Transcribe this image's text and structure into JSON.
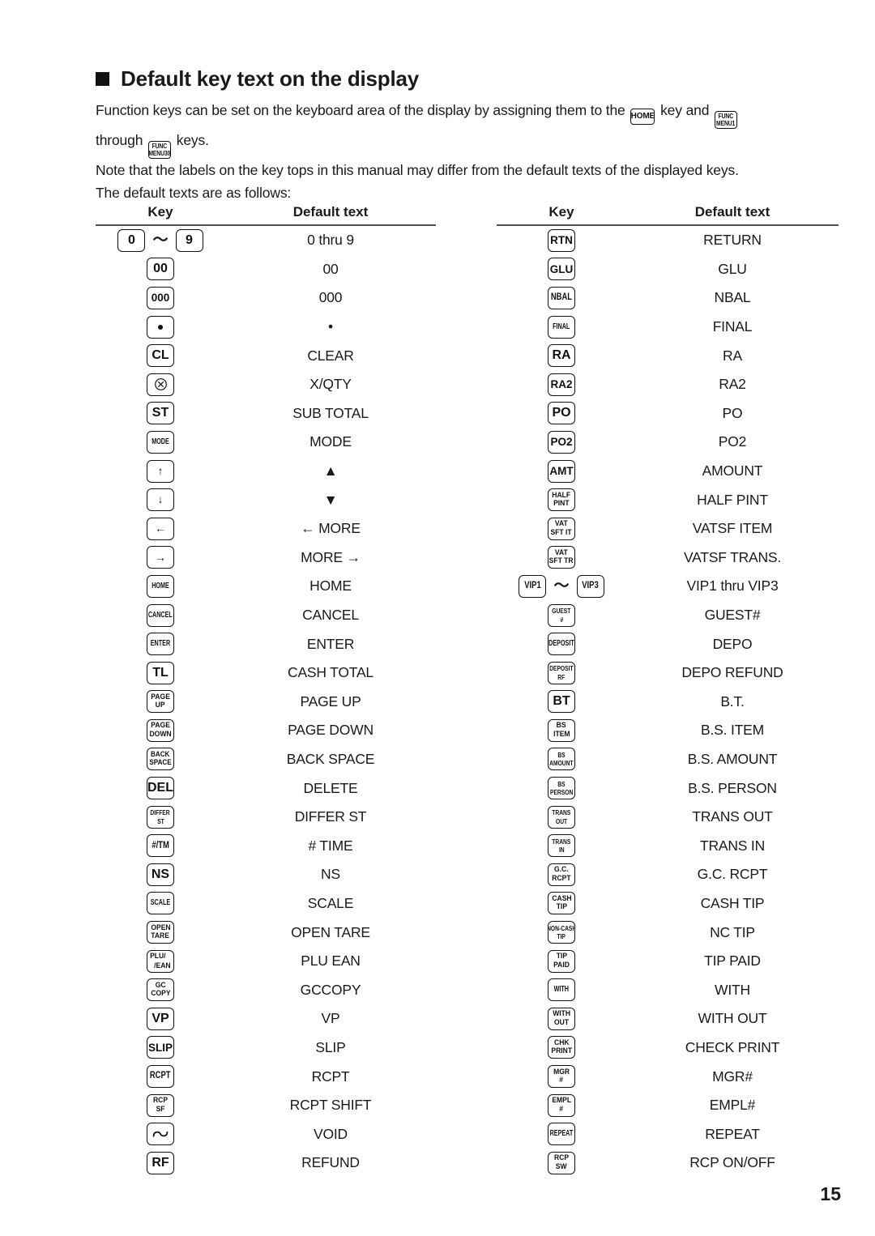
{
  "heading": {
    "bullet": "filled-square",
    "title": "Default key text on the display"
  },
  "intro": {
    "line1_a": "Function keys can be set on the keyboard area of the display by assigning them to the",
    "key_home": "HOME",
    "line1_b": "key and",
    "key_func_menu1_l1": "FUNC",
    "key_func_menu1_l2": "MENU1",
    "line2_a": "through",
    "key_func_menu30_l1": "FUNC",
    "key_func_menu30_l2": "MENU30",
    "line2_b": "keys.",
    "line3": "Note that the labels on the key tops in this manual may differ from the default texts of the displayed keys.",
    "line4": "The default texts are as follows:"
  },
  "table_headers": {
    "key": "Key",
    "default_text": "Default text"
  },
  "left_rows": [
    {
      "keys": [
        {
          "l1": "0",
          "style": "s1"
        },
        {
          "tilde": "〜"
        },
        {
          "l1": "9",
          "style": "s1"
        }
      ],
      "text": "0 thru 9"
    },
    {
      "keys": [
        {
          "l1": "00",
          "style": "s1"
        }
      ],
      "text": "00"
    },
    {
      "keys": [
        {
          "l1": "000",
          "style": "s2"
        }
      ],
      "text": "000"
    },
    {
      "keys": [
        {
          "glyph": "dot"
        }
      ],
      "text": "•"
    },
    {
      "keys": [
        {
          "l1": "CL",
          "style": "s1"
        }
      ],
      "text": "CLEAR"
    },
    {
      "keys": [
        {
          "glyph": "circle-x"
        }
      ],
      "text": "X/QTY"
    },
    {
      "keys": [
        {
          "l1": "ST",
          "style": "s1"
        }
      ],
      "text": "SUB TOTAL"
    },
    {
      "keys": [
        {
          "l1": "MODE",
          "style": "s4"
        }
      ],
      "text": "MODE"
    },
    {
      "keys": [
        {
          "l1": "↑",
          "style": "s2"
        }
      ],
      "text": "▲"
    },
    {
      "keys": [
        {
          "l1": "↓",
          "style": "s2"
        }
      ],
      "text": "▼"
    },
    {
      "keys": [
        {
          "l1": "←",
          "style": "s2"
        }
      ],
      "text": "← MORE"
    },
    {
      "keys": [
        {
          "l1": "→",
          "style": "s2"
        }
      ],
      "text": "MORE →"
    },
    {
      "keys": [
        {
          "l1": "HOME",
          "style": "s4"
        }
      ],
      "text": "HOME"
    },
    {
      "keys": [
        {
          "l1": "CANCEL",
          "style": "s4"
        }
      ],
      "text": "CANCEL"
    },
    {
      "keys": [
        {
          "l1": "ENTER",
          "style": "s4"
        }
      ],
      "text": "ENTER"
    },
    {
      "keys": [
        {
          "l1": "TL",
          "style": "s1"
        }
      ],
      "text": "CASH TOTAL"
    },
    {
      "keys": [
        {
          "l1": "PAGE",
          "l2": "UP",
          "style": "dbl"
        }
      ],
      "text": "PAGE UP"
    },
    {
      "keys": [
        {
          "l1": "PAGE",
          "l2": "DOWN",
          "style": "dbl"
        }
      ],
      "text": "PAGE DOWN"
    },
    {
      "keys": [
        {
          "l1": "BACK",
          "l2": "SPACE",
          "style": "bs-parens"
        }
      ],
      "text": "BACK SPACE"
    },
    {
      "keys": [
        {
          "l1": "DEL",
          "style": "s1"
        }
      ],
      "text": "DELETE"
    },
    {
      "keys": [
        {
          "l1": "DIFFER",
          "l2": "ST",
          "style": "dbl narrow"
        }
      ],
      "text": "DIFFER ST"
    },
    {
      "keys": [
        {
          "l1": "#/TM",
          "style": "s3"
        }
      ],
      "text": "# TIME"
    },
    {
      "keys": [
        {
          "l1": "NS",
          "style": "s1"
        }
      ],
      "text": "NS"
    },
    {
      "keys": [
        {
          "l1": "SCALE",
          "style": "s4"
        }
      ],
      "text": "SCALE"
    },
    {
      "keys": [
        {
          "l1": "OPEN",
          "l2": "TARE",
          "style": "dbl"
        }
      ],
      "text": "OPEN TARE"
    },
    {
      "keys": [
        {
          "l1": "PLU/",
          "l2": "/EAN",
          "style": "plu-ean"
        }
      ],
      "text": "PLU EAN"
    },
    {
      "keys": [
        {
          "l1": "GC",
          "l2": "COPY",
          "style": "dbl"
        }
      ],
      "text": "GCCOPY"
    },
    {
      "keys": [
        {
          "l1": "VP",
          "style": "s1"
        }
      ],
      "text": "VP"
    },
    {
      "keys": [
        {
          "l1": "SLIP",
          "style": "s2"
        }
      ],
      "text": "SLIP"
    },
    {
      "keys": [
        {
          "l1": "RCPT",
          "style": "s3"
        }
      ],
      "text": "RCPT"
    },
    {
      "keys": [
        {
          "l1": "RCP",
          "l2": "SF",
          "style": "dbl"
        }
      ],
      "text": "RCPT SHIFT"
    },
    {
      "keys": [
        {
          "glyph": "void"
        }
      ],
      "text": "VOID"
    },
    {
      "keys": [
        {
          "l1": "RF",
          "style": "s1"
        }
      ],
      "text": "REFUND"
    }
  ],
  "right_rows": [
    {
      "keys": [
        {
          "l1": "RTN",
          "style": "s2"
        }
      ],
      "text": "RETURN"
    },
    {
      "keys": [
        {
          "l1": "GLU",
          "style": "s2"
        }
      ],
      "text": "GLU"
    },
    {
      "keys": [
        {
          "l1": "NBAL",
          "style": "s3"
        }
      ],
      "text": "NBAL"
    },
    {
      "keys": [
        {
          "l1": "FINAL",
          "style": "s4"
        }
      ],
      "text": "FINAL"
    },
    {
      "keys": [
        {
          "l1": "RA",
          "style": "s1"
        }
      ],
      "text": "RA"
    },
    {
      "keys": [
        {
          "l1": "RA2",
          "style": "s2"
        }
      ],
      "text": "RA2"
    },
    {
      "keys": [
        {
          "l1": "PO",
          "style": "s1"
        }
      ],
      "text": "PO"
    },
    {
      "keys": [
        {
          "l1": "PO2",
          "style": "s2"
        }
      ],
      "text": "PO2"
    },
    {
      "keys": [
        {
          "l1": "AMT",
          "style": "s2"
        }
      ],
      "text": "AMOUNT"
    },
    {
      "keys": [
        {
          "l1": "HALF",
          "l2": "PINT",
          "style": "dbl"
        }
      ],
      "text": "HALF PINT"
    },
    {
      "keys": [
        {
          "l1": "VAT",
          "l2": "SFT IT",
          "style": "dbl"
        }
      ],
      "text": "VATSF ITEM"
    },
    {
      "keys": [
        {
          "l1": "VAT",
          "l2": "SFT TR",
          "style": "dbl"
        }
      ],
      "text": "VATSF TRANS."
    },
    {
      "keys": [
        {
          "l1": "VIP1",
          "style": "s3"
        },
        {
          "tilde": "〜"
        },
        {
          "l1": "VIP3",
          "style": "s3"
        }
      ],
      "text": "VIP1 thru VIP3"
    },
    {
      "keys": [
        {
          "l1": "GUEST",
          "l2": "#",
          "style": "dbl narrow"
        }
      ],
      "text": "GUEST#"
    },
    {
      "keys": [
        {
          "l1": "DEPOSIT",
          "style": "s4"
        }
      ],
      "text": "DEPO"
    },
    {
      "keys": [
        {
          "l1": "DEPOSIT",
          "l2": "RF",
          "style": "dbl narrow"
        }
      ],
      "text": "DEPO REFUND"
    },
    {
      "keys": [
        {
          "l1": "BT",
          "style": "s1"
        }
      ],
      "text": "B.T."
    },
    {
      "keys": [
        {
          "l1": "BS",
          "l2": "ITEM",
          "style": "dbl"
        }
      ],
      "text": "B.S. ITEM"
    },
    {
      "keys": [
        {
          "l1": "BS",
          "l2": "AMOUNT",
          "style": "dbl narrow"
        }
      ],
      "text": "B.S. AMOUNT"
    },
    {
      "keys": [
        {
          "l1": "BS",
          "l2": "PERSON",
          "style": "dbl narrow"
        }
      ],
      "text": "B.S. PERSON"
    },
    {
      "keys": [
        {
          "l1": "TRANS",
          "l2": "OUT",
          "style": "dbl narrow"
        }
      ],
      "text": "TRANS OUT"
    },
    {
      "keys": [
        {
          "l1": "TRANS",
          "l2": "IN",
          "style": "dbl narrow"
        }
      ],
      "text": "TRANS IN"
    },
    {
      "keys": [
        {
          "l1": "G.C.",
          "l2": "RCPT",
          "style": "dbl"
        }
      ],
      "text": "G.C. RCPT"
    },
    {
      "keys": [
        {
          "l1": "CASH",
          "l2": "TIP",
          "style": "dbl"
        }
      ],
      "text": "CASH TIP"
    },
    {
      "keys": [
        {
          "l1": "NON-CASH",
          "l2": "TIP",
          "style": "dbl narrow"
        }
      ],
      "text": "NC TIP"
    },
    {
      "keys": [
        {
          "l1": "TIP",
          "l2": "PAID",
          "style": "dbl"
        }
      ],
      "text": "TIP PAID"
    },
    {
      "keys": [
        {
          "l1": "WITH",
          "style": "s4"
        }
      ],
      "text": "WITH"
    },
    {
      "keys": [
        {
          "l1": "WITH",
          "l2": "OUT",
          "style": "dbl"
        }
      ],
      "text": "WITH OUT"
    },
    {
      "keys": [
        {
          "l1": "CHK",
          "l2": "PRINT",
          "style": "dbl"
        }
      ],
      "text": "CHECK PRINT"
    },
    {
      "keys": [
        {
          "l1": "MGR",
          "l2": "#",
          "style": "dbl"
        }
      ],
      "text": "MGR#"
    },
    {
      "keys": [
        {
          "l1": "EMPL",
          "l2": "#",
          "style": "dbl"
        }
      ],
      "text": "EMPL#"
    },
    {
      "keys": [
        {
          "l1": "REPEAT",
          "style": "s4"
        }
      ],
      "text": "REPEAT"
    },
    {
      "keys": [
        {
          "l1": "RCP",
          "l2": "SW",
          "style": "dbl"
        }
      ],
      "text": "RCP ON/OFF"
    }
  ],
  "page_number": "15"
}
